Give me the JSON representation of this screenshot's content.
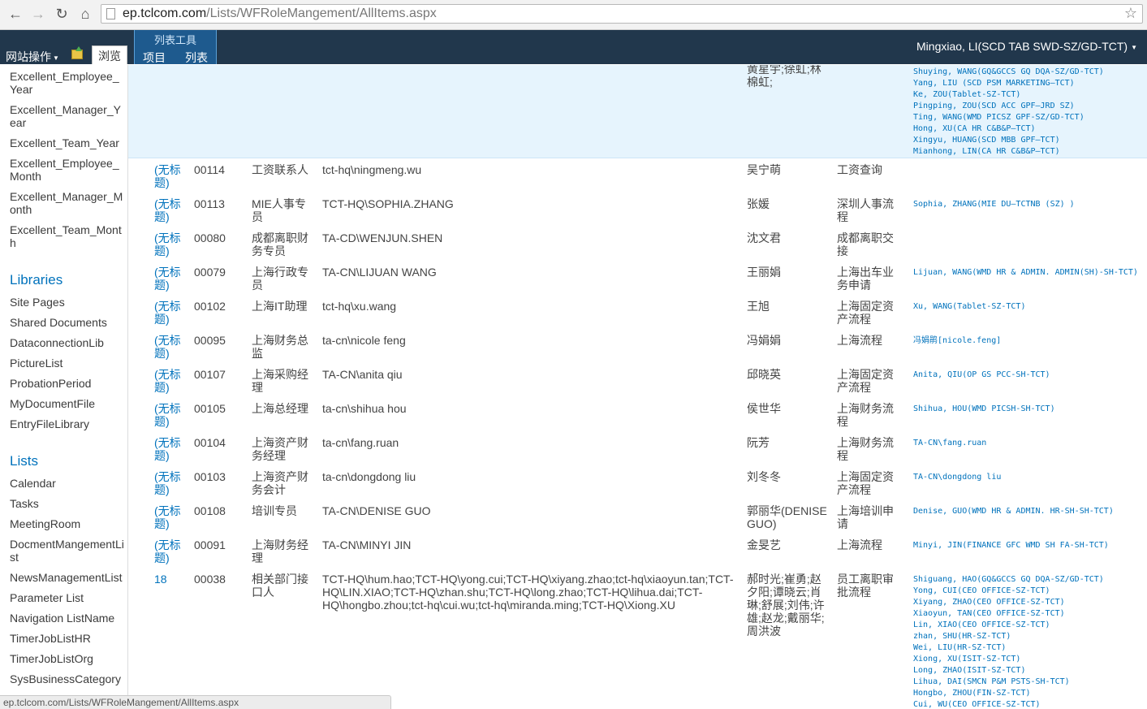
{
  "browser": {
    "url_host": "ep.tclcom.com",
    "url_path": "/Lists/WFRoleMangement/AllItems.aspx",
    "status_url": "ep.tclcom.com/Lists/WFRoleMangement/AllItems.aspx",
    "icons": [
      "back-icon",
      "forward-icon",
      "reload-icon",
      "home-icon",
      "star-icon"
    ]
  },
  "ribbon": {
    "site_actions": "网站操作",
    "browse_tab": "浏览",
    "tool_group": "列表工具",
    "tab_items": "项目",
    "tab_list": "列表",
    "user": "Mingxiao, LI(SCD TAB SWD-SZ/GD-TCT)"
  },
  "quicklaunch": {
    "top_items": [
      "Excellent_Employee_Year",
      "Excellent_Manager_Year",
      "Excellent_Team_Year",
      "Excellent_Employee_Month",
      "Excellent_Manager_Month",
      "Excellent_Team_Month"
    ],
    "libraries_heading": "Libraries",
    "libraries": [
      "Site Pages",
      "Shared Documents",
      "DataconnectionLib",
      "PictureList",
      "ProbationPeriod",
      "MyDocumentFile",
      "EntryFileLibrary"
    ],
    "lists_heading": "Lists",
    "lists": [
      "Calendar",
      "Tasks",
      "MeetingRoom",
      "DocmentMangementList",
      "NewsManagementList",
      "Parameter List",
      "Navigation ListName",
      "TimerJobListHR",
      "TimerJobListOrg",
      "SysBusinessCategory"
    ]
  },
  "top_row": {
    "names": "黄星宇;徐虹;林棉虹;",
    "wf": "Shuying, WANG(GQ&GCCS GQ DQA-SZ/GD-TCT)\nYang, LIU (SCD PSM MARKETING—TCT)\nKe, ZOU(Tablet-SZ-TCT)\nPingping, ZOU(SCD ACC GPF—JRD SZ)\nTing, WANG(WMD PICSZ GPF-SZ/GD-TCT)\nHong, XU(CA HR C&B&P—TCT)\nXingyu, HUANG(SCD MBB GPF—TCT)\nMianhong, LIN(CA HR C&B&P—TCT)"
  },
  "rows": [
    {
      "title": "(无标题)",
      "code": "00114",
      "role": "工资联系人",
      "account": "tct-hq\\ningmeng.wu",
      "name": "吴宁萌",
      "process": "工资查询",
      "wf": ""
    },
    {
      "title": "(无标题)",
      "code": "00113",
      "role": "MIE人事专员",
      "account": "TCT-HQ\\SOPHIA.ZHANG",
      "name": "张媛",
      "process": "深圳人事流程",
      "wf": "Sophia, ZHANG(MIE DU—TCTNB (SZ) )"
    },
    {
      "title": "(无标题)",
      "code": "00080",
      "role": "成都离职财务专员",
      "account": "TA-CD\\WENJUN.SHEN",
      "name": "沈文君",
      "process": "成都离职交接",
      "wf": ""
    },
    {
      "title": "(无标题)",
      "code": "00079",
      "role": "上海行政专员",
      "account": "TA-CN\\LIJUAN WANG",
      "name": "王丽娟",
      "process": "上海出车业务申请",
      "wf": "Lijuan, WANG(WMD HR & ADMIN. ADMIN(SH)-SH-TCT)"
    },
    {
      "title": "(无标题)",
      "code": "00102",
      "role": "上海IT助理",
      "account": "tct-hq\\xu.wang",
      "name": "王旭",
      "process": "上海固定资产流程",
      "wf": "Xu, WANG(Tablet-SZ-TCT)"
    },
    {
      "title": "(无标题)",
      "code": "00095",
      "role": "上海财务总监",
      "account": "ta-cn\\nicole feng",
      "name": "冯娟娟",
      "process": "上海流程",
      "wf": "冯娟鹃[nicole.feng]"
    },
    {
      "title": "(无标题)",
      "code": "00107",
      "role": "上海采购经理",
      "account": "TA-CN\\anita qiu",
      "name": "邱晓英",
      "process": "上海固定资产流程",
      "wf": "Anita, QIU(OP GS PCC-SH-TCT)"
    },
    {
      "title": "(无标题)",
      "code": "00105",
      "role": "上海总经理",
      "account": "ta-cn\\shihua hou",
      "name": "侯世华",
      "process": "上海财务流程",
      "wf": "Shihua, HOU(WMD PICSH-SH-TCT)"
    },
    {
      "title": "(无标题)",
      "code": "00104",
      "role": "上海资产财务经理",
      "account": "ta-cn\\fang.ruan",
      "name": "阮芳",
      "process": "上海财务流程",
      "wf": "TA-CN\\fang.ruan"
    },
    {
      "title": "(无标题)",
      "code": "00103",
      "role": "上海资产财务会计",
      "account": "ta-cn\\dongdong liu",
      "name": "刘冬冬",
      "process": "上海固定资产流程",
      "wf": "TA-CN\\dongdong liu"
    },
    {
      "title": "(无标题)",
      "code": "00108",
      "role": "培训专员",
      "account": "TA-CN\\DENISE GUO",
      "name": "郭丽华(DENISE GUO)",
      "process": "上海培训申请",
      "wf": "Denise, GUO(WMD HR & ADMIN. HR-SH-SH-TCT)"
    },
    {
      "title": "(无标题)",
      "code": "00091",
      "role": "上海财务经理",
      "account": "TA-CN\\MINYI JIN",
      "name": "金旻艺",
      "process": "上海流程",
      "wf": "Minyi, JIN(FINANCE GFC WMD SH FA-SH-TCT)"
    },
    {
      "title": "18",
      "code": "00038",
      "role": "相关部门接口人",
      "account": "TCT-HQ\\hum.hao;TCT-HQ\\yong.cui;TCT-HQ\\xiyang.zhao;tct-hq\\xiaoyun.tan;TCT-HQ\\LIN.XIAO;TCT-HQ\\zhan.shu;TCT-HQ\\long.zhao;TCT-HQ\\lihua.dai;TCT-HQ\\hongbo.zhou;tct-hq\\cui.wu;tct-hq\\miranda.ming;TCT-HQ\\Xiong.XU",
      "name": "郝时光;崔勇;赵夕阳;谭晓云;肖琳;舒展;刘伟;许雄;赵龙;戴丽华;周洪波",
      "process": "员工离职审批流程",
      "wf": "Shiguang, HAO(GQ&GCCS GQ DQA-SZ/GD-TCT)\nYong, CUI(CEO OFFICE-SZ-TCT)\nXiyang, ZHAO(CEO OFFICE-SZ-TCT)\nXiaoyun, TAN(CEO OFFICE-SZ-TCT)\nLin, XIAO(CEO OFFICE-SZ-TCT)\nzhan, SHU(HR-SZ-TCT)\nWei, LIU(HR-SZ-TCT)\nXiong, XU(ISIT-SZ-TCT)\nLong, ZHAO(ISIT-SZ-TCT)\nLihua, DAI(SMCN P&M PSTS-SH-TCT)\nHongbo, ZHOU(FIN-SZ-TCT)\nCui, WU(CEO OFFICE-SZ-TCT)"
    }
  ]
}
